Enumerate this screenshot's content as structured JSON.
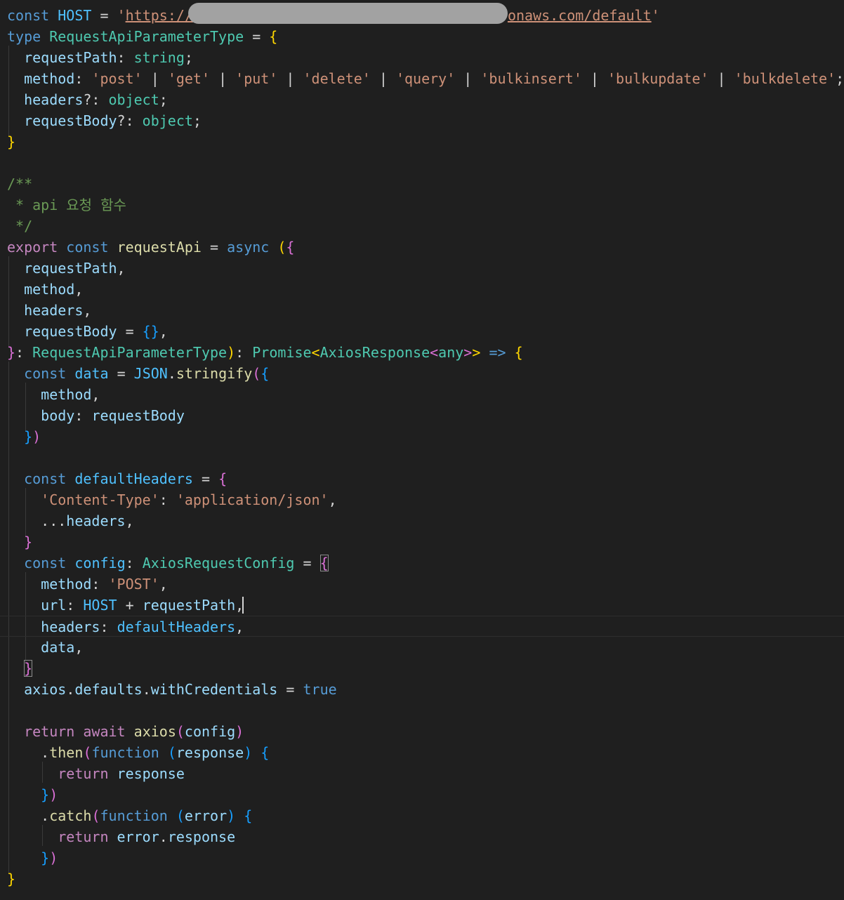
{
  "editor": {
    "language": "typescript",
    "theme": "dark",
    "redacted_segment": "blurred hostname in HOST url",
    "cursor_line": 29,
    "lines": [
      [
        [
          "kw",
          "const"
        ],
        [
          "p",
          " "
        ],
        [
          "cst",
          "HOST"
        ],
        [
          "p",
          " = "
        ],
        [
          "str",
          "'"
        ],
        [
          "str url",
          "https://"
        ],
        [
          "redact",
          ""
        ],
        [
          "str url",
          "onaws.com/default"
        ],
        [
          "str",
          "'"
        ]
      ],
      [
        [
          "kw",
          "type"
        ],
        [
          "p",
          " "
        ],
        [
          "typ",
          "RequestApiParameterType"
        ],
        [
          "p",
          " = "
        ],
        [
          "b1",
          "{"
        ]
      ],
      [
        [
          "p",
          "  "
        ],
        [
          "var",
          "requestPath"
        ],
        [
          "p",
          ": "
        ],
        [
          "typ",
          "string"
        ],
        [
          "p",
          ";"
        ]
      ],
      [
        [
          "p",
          "  "
        ],
        [
          "var",
          "method"
        ],
        [
          "p",
          ": "
        ],
        [
          "str",
          "'post'"
        ],
        [
          "p",
          " | "
        ],
        [
          "str",
          "'get'"
        ],
        [
          "p",
          " | "
        ],
        [
          "str",
          "'put'"
        ],
        [
          "p",
          " | "
        ],
        [
          "str",
          "'delete'"
        ],
        [
          "p",
          " | "
        ],
        [
          "str",
          "'query'"
        ],
        [
          "p",
          " | "
        ],
        [
          "str",
          "'bulkinsert'"
        ],
        [
          "p",
          " | "
        ],
        [
          "str",
          "'bulkupdate'"
        ],
        [
          "p",
          " | "
        ],
        [
          "str",
          "'bulkdelete'"
        ],
        [
          "p",
          ";"
        ]
      ],
      [
        [
          "p",
          "  "
        ],
        [
          "var",
          "headers"
        ],
        [
          "p",
          "?: "
        ],
        [
          "typ",
          "object"
        ],
        [
          "p",
          ";"
        ]
      ],
      [
        [
          "p",
          "  "
        ],
        [
          "var",
          "requestBody"
        ],
        [
          "p",
          "?: "
        ],
        [
          "typ",
          "object"
        ],
        [
          "p",
          ";"
        ]
      ],
      [
        [
          "b1",
          "}"
        ]
      ],
      [],
      [
        [
          "cmt",
          "/**"
        ]
      ],
      [
        [
          "cmt",
          " * api 요청 함수"
        ]
      ],
      [
        [
          "cmt",
          " */"
        ]
      ],
      [
        [
          "ctl",
          "export"
        ],
        [
          "p",
          " "
        ],
        [
          "kw",
          "const"
        ],
        [
          "p",
          " "
        ],
        [
          "fn",
          "requestApi"
        ],
        [
          "p",
          " = "
        ],
        [
          "kw",
          "async"
        ],
        [
          "p",
          " "
        ],
        [
          "b1",
          "("
        ],
        [
          "b2",
          "{"
        ]
      ],
      [
        [
          "p",
          "  "
        ],
        [
          "var",
          "requestPath"
        ],
        [
          "p",
          ","
        ]
      ],
      [
        [
          "p",
          "  "
        ],
        [
          "var",
          "method"
        ],
        [
          "p",
          ","
        ]
      ],
      [
        [
          "p",
          "  "
        ],
        [
          "var",
          "headers"
        ],
        [
          "p",
          ","
        ]
      ],
      [
        [
          "p",
          "  "
        ],
        [
          "var",
          "requestBody"
        ],
        [
          "p",
          " = "
        ],
        [
          "b3",
          "{}"
        ],
        [
          "p",
          ","
        ]
      ],
      [
        [
          "b2",
          "}"
        ],
        [
          "p",
          ": "
        ],
        [
          "typ",
          "RequestApiParameterType"
        ],
        [
          "b1",
          ")"
        ],
        [
          "p",
          ": "
        ],
        [
          "typ",
          "Promise"
        ],
        [
          "b1",
          "<"
        ],
        [
          "typ",
          "AxiosResponse"
        ],
        [
          "b2",
          "<"
        ],
        [
          "typ",
          "any"
        ],
        [
          "b2",
          ">"
        ],
        [
          "b1",
          ">"
        ],
        [
          "p",
          " "
        ],
        [
          "kw",
          "=>"
        ],
        [
          "p",
          " "
        ],
        [
          "b1",
          "{"
        ]
      ],
      [
        [
          "p",
          "  "
        ],
        [
          "kw",
          "const"
        ],
        [
          "p",
          " "
        ],
        [
          "cst",
          "data"
        ],
        [
          "p",
          " = "
        ],
        [
          "cst",
          "JSON"
        ],
        [
          "p",
          "."
        ],
        [
          "fn",
          "stringify"
        ],
        [
          "b2",
          "("
        ],
        [
          "b3",
          "{"
        ]
      ],
      [
        [
          "p",
          "    "
        ],
        [
          "var",
          "method"
        ],
        [
          "p",
          ","
        ]
      ],
      [
        [
          "p",
          "    "
        ],
        [
          "var",
          "body"
        ],
        [
          "p",
          ": "
        ],
        [
          "var",
          "requestBody"
        ]
      ],
      [
        [
          "p",
          "  "
        ],
        [
          "b3",
          "}"
        ],
        [
          "b2",
          ")"
        ]
      ],
      [],
      [
        [
          "p",
          "  "
        ],
        [
          "kw",
          "const"
        ],
        [
          "p",
          " "
        ],
        [
          "cst",
          "defaultHeaders"
        ],
        [
          "p",
          " = "
        ],
        [
          "b2",
          "{"
        ]
      ],
      [
        [
          "p",
          "    "
        ],
        [
          "str",
          "'Content-Type'"
        ],
        [
          "p",
          ": "
        ],
        [
          "str",
          "'application/json'"
        ],
        [
          "p",
          ","
        ]
      ],
      [
        [
          "p",
          "    ..."
        ],
        [
          "var",
          "headers"
        ],
        [
          "p",
          ","
        ]
      ],
      [
        [
          "p",
          "  "
        ],
        [
          "b2",
          "}"
        ]
      ],
      [
        [
          "p",
          "  "
        ],
        [
          "kw",
          "const"
        ],
        [
          "p",
          " "
        ],
        [
          "cst",
          "config"
        ],
        [
          "p",
          ": "
        ],
        [
          "typ",
          "AxiosRequestConfig"
        ],
        [
          "p",
          " = "
        ],
        [
          "b2 bm",
          "{"
        ]
      ],
      [
        [
          "p",
          "    "
        ],
        [
          "var",
          "method"
        ],
        [
          "p",
          ": "
        ],
        [
          "str",
          "'POST'"
        ],
        [
          "p",
          ","
        ]
      ],
      [
        [
          "p",
          "    "
        ],
        [
          "var",
          "url"
        ],
        [
          "p",
          ": "
        ],
        [
          "cst",
          "HOST"
        ],
        [
          "p",
          " + "
        ],
        [
          "var",
          "requestPath"
        ],
        [
          "p",
          ","
        ]
      ],
      [
        [
          "p",
          "    "
        ],
        [
          "var",
          "headers"
        ],
        [
          "p",
          ": "
        ],
        [
          "cst",
          "defaultHeaders"
        ],
        [
          "p",
          ","
        ]
      ],
      [
        [
          "p",
          "    "
        ],
        [
          "var",
          "data"
        ],
        [
          "p",
          ","
        ]
      ],
      [
        [
          "p",
          "  "
        ],
        [
          "b2 bm",
          "}"
        ]
      ],
      [
        [
          "p",
          "  "
        ],
        [
          "var",
          "axios"
        ],
        [
          "p",
          "."
        ],
        [
          "var",
          "defaults"
        ],
        [
          "p",
          "."
        ],
        [
          "var",
          "withCredentials"
        ],
        [
          "p",
          " = "
        ],
        [
          "kw",
          "true"
        ]
      ],
      [],
      [
        [
          "p",
          "  "
        ],
        [
          "ctl",
          "return"
        ],
        [
          "p",
          " "
        ],
        [
          "ctl",
          "await"
        ],
        [
          "p",
          " "
        ],
        [
          "fn",
          "axios"
        ],
        [
          "b2",
          "("
        ],
        [
          "var",
          "config"
        ],
        [
          "b2",
          ")"
        ]
      ],
      [
        [
          "p",
          "    ."
        ],
        [
          "fn",
          "then"
        ],
        [
          "b2",
          "("
        ],
        [
          "kw",
          "function"
        ],
        [
          "p",
          " "
        ],
        [
          "b3",
          "("
        ],
        [
          "var",
          "response"
        ],
        [
          "b3",
          ")"
        ],
        [
          "p",
          " "
        ],
        [
          "b3",
          "{"
        ]
      ],
      [
        [
          "p",
          "      "
        ],
        [
          "ctl",
          "return"
        ],
        [
          "p",
          " "
        ],
        [
          "var",
          "response"
        ]
      ],
      [
        [
          "p",
          "    "
        ],
        [
          "b3",
          "}"
        ],
        [
          "b2",
          ")"
        ]
      ],
      [
        [
          "p",
          "    ."
        ],
        [
          "fn",
          "catch"
        ],
        [
          "b2",
          "("
        ],
        [
          "kw",
          "function"
        ],
        [
          "p",
          " "
        ],
        [
          "b3",
          "("
        ],
        [
          "var",
          "error"
        ],
        [
          "b3",
          ")"
        ],
        [
          "p",
          " "
        ],
        [
          "b3",
          "{"
        ]
      ],
      [
        [
          "p",
          "      "
        ],
        [
          "ctl",
          "return"
        ],
        [
          "p",
          " "
        ],
        [
          "var",
          "error"
        ],
        [
          "p",
          "."
        ],
        [
          "var",
          "response"
        ]
      ],
      [
        [
          "p",
          "    "
        ],
        [
          "b3",
          "}"
        ],
        [
          "b2",
          ")"
        ]
      ],
      [
        [
          "b1",
          "}"
        ]
      ]
    ]
  }
}
